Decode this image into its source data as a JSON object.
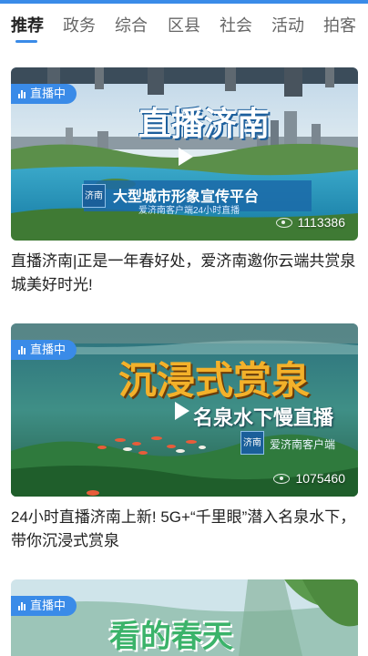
{
  "tabs": [
    {
      "label": "推荐",
      "active": true
    },
    {
      "label": "政务",
      "active": false
    },
    {
      "label": "综合",
      "active": false
    },
    {
      "label": "区县",
      "active": false
    },
    {
      "label": "社会",
      "active": false
    },
    {
      "label": "活动",
      "active": false
    },
    {
      "label": "拍客",
      "active": false
    }
  ],
  "accent_color": "#3a8be8",
  "cards": [
    {
      "badge": "直播中",
      "overlay_title": "直播济南",
      "overlay_subtitle": "大型城市形象宣传平台",
      "overlay_logo": "济南",
      "overlay_caption": "爱济南客户端24小时直播",
      "views": "1113386",
      "headline": "直播济南|正是一年春好处，爱济南邀你云端共赏泉城美好时光!"
    },
    {
      "badge": "直播中",
      "overlay_title": "沉浸式赏泉",
      "overlay_subtitle": "名泉水下慢直播",
      "overlay_logo": "济南",
      "overlay_caption": "爱济南客户端",
      "views": "1075460",
      "headline": "24小时直播济南上新! 5G+“千里眼”潜入名泉水下，带你沉浸式赏泉"
    },
    {
      "badge": "直播中",
      "overlay_title": "看的春天"
    }
  ]
}
